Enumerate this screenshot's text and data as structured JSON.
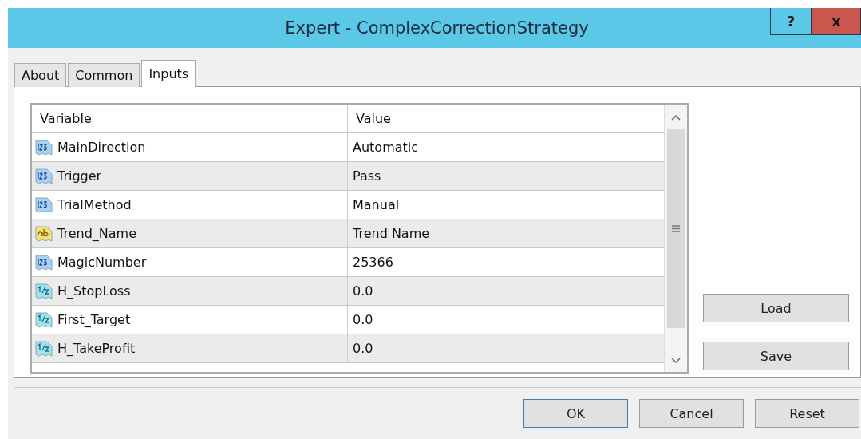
{
  "window": {
    "title": "Expert - ComplexCorrectionStrategy",
    "help": "?",
    "close": "x"
  },
  "tabs": [
    {
      "label": "About",
      "selected": false
    },
    {
      "label": "Common",
      "selected": false
    },
    {
      "label": "Inputs",
      "selected": true
    }
  ],
  "table": {
    "columns": [
      "Variable",
      "Value"
    ],
    "rows": [
      {
        "kind": "int",
        "variable": "MainDirection",
        "value": "Automatic"
      },
      {
        "kind": "int",
        "variable": "Trigger",
        "value": "Pass"
      },
      {
        "kind": "int",
        "variable": "TrialMethod",
        "value": "Manual"
      },
      {
        "kind": "string",
        "variable": "Trend_Name",
        "value": "Trend Name"
      },
      {
        "kind": "int",
        "variable": "MagicNumber",
        "value": "25366"
      },
      {
        "kind": "double",
        "variable": "H_StopLoss",
        "value": "0.0"
      },
      {
        "kind": "double",
        "variable": "First_Target",
        "value": "0.0"
      },
      {
        "kind": "double",
        "variable": "H_TakeProfit",
        "value": "0.0"
      }
    ]
  },
  "side_buttons": [
    "Load",
    "Save"
  ],
  "buttons": [
    {
      "label": "OK",
      "default": true
    },
    {
      "label": "Cancel",
      "default": false
    },
    {
      "label": "Reset",
      "default": false
    }
  ]
}
